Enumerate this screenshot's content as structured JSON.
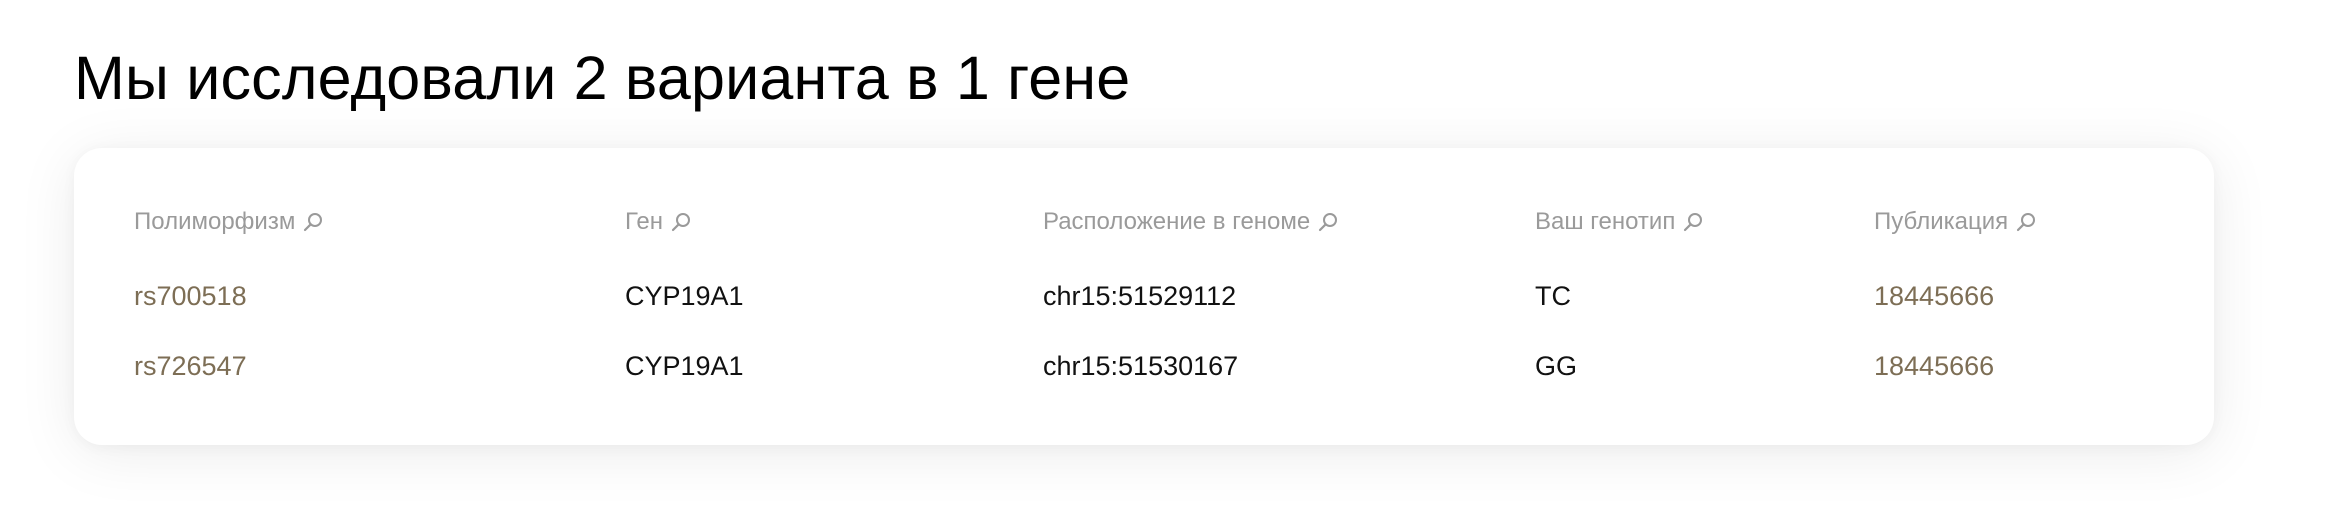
{
  "page_title": "Мы исследовали 2 варианта в 1 гене",
  "colors": {
    "link": "#7d6e55",
    "header_text": "#9a9a9a",
    "body_text": "#111111"
  },
  "table": {
    "headers": [
      {
        "label": "Полиморфизм",
        "icon": "search-icon"
      },
      {
        "label": "Ген",
        "icon": "search-icon"
      },
      {
        "label": "Расположение в геноме",
        "icon": "search-icon"
      },
      {
        "label": "Ваш генотип",
        "icon": "search-icon"
      },
      {
        "label": "Публикация",
        "icon": "search-icon"
      }
    ],
    "rows": [
      {
        "polymorphism": "rs700518",
        "gene": "CYP19A1",
        "location": "chr15:51529112",
        "genotype": "TC",
        "publication": "18445666"
      },
      {
        "polymorphism": "rs726547",
        "gene": "CYP19A1",
        "location": "chr15:51530167",
        "genotype": "GG",
        "publication": "18445666"
      }
    ]
  }
}
